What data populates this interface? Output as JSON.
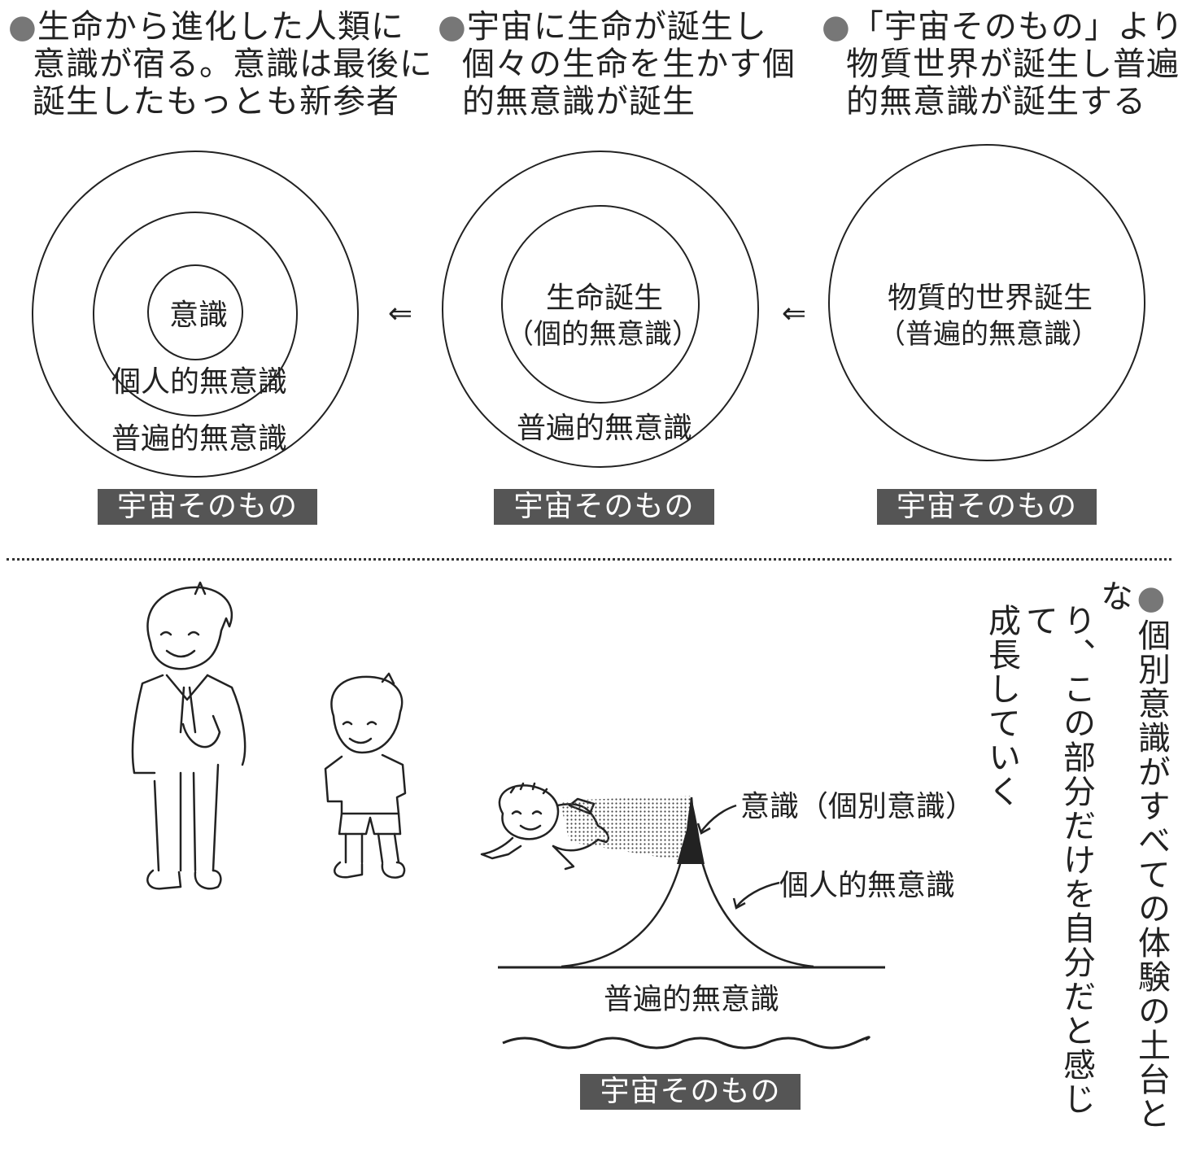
{
  "headers": [
    {
      "bullet": "●",
      "lines": [
        "生命から進化した人類に",
        "意識が宿る。意識は最後に",
        "誕生したもっとも新参者"
      ]
    },
    {
      "bullet": "●",
      "lines": [
        "宇宙に生命が誕生し",
        "個々の生命を生かす個",
        "的無意識が誕生"
      ]
    },
    {
      "bullet": "●",
      "lines": [
        "「宇宙そのもの」より",
        "物質世界が誕生し普遍",
        "的無意識が誕生する"
      ]
    }
  ],
  "diagram1": {
    "inner": "意識",
    "middle": "個人的無意識",
    "outer": "普遍的無意識",
    "box": "宇宙そのもの"
  },
  "diagram2": {
    "inner_line1": "生命誕生",
    "inner_line2": "（個的無意識）",
    "outer": "普遍的無意識",
    "box": "宇宙そのもの"
  },
  "diagram3": {
    "line1": "物質的世界誕生",
    "line2": "（普遍的無意識）",
    "box": "宇宙そのもの"
  },
  "arrows": [
    "⇐",
    "⇐"
  ],
  "bottom": {
    "label_consciousness": "意識（個別意識）",
    "label_personal": "個人的無意識",
    "label_universal": "普遍的無意識",
    "box": "宇宙そのもの",
    "vertical_bullet": "●",
    "vertical_lines": [
      "個別意識がすべての体験の土台とな",
      "り、この部分だけを自分だと感じて",
      "成長していく"
    ]
  }
}
